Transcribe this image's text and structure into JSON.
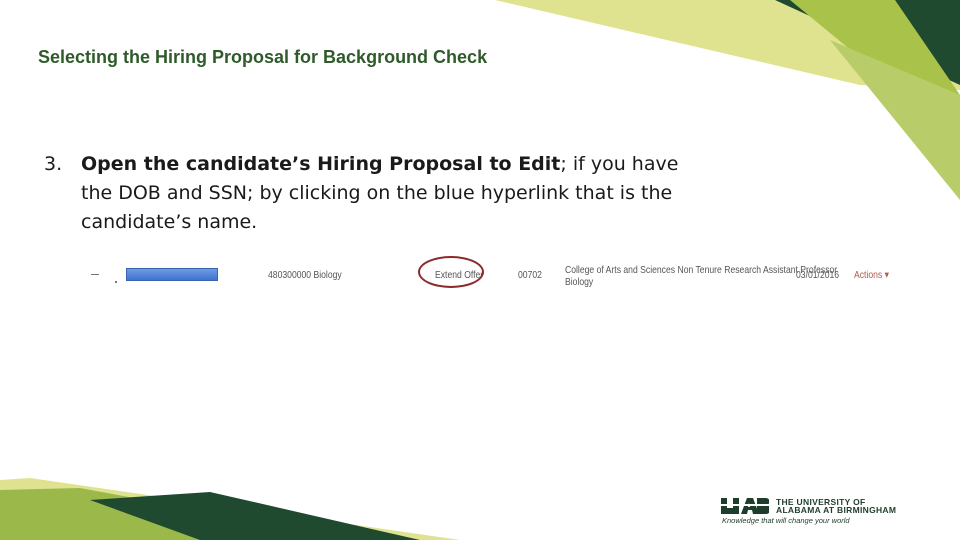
{
  "slide": {
    "title": "Selecting the Hiring Proposal for Background Check",
    "step": {
      "number": "3.",
      "bold_text": "Open the candidate’s Hiring Proposal to Edit",
      "rest_text": "; if you have the DOB and SSN; by clicking on the blue hyperlink that is the candidate’s name."
    }
  },
  "screenshot_row": {
    "department": "480300000 Biology",
    "status": "Extend Offer",
    "code": "00702",
    "position_line1": "College of Arts and Sciences Non Tenure Research Assistant Professor",
    "position_line2": "Biology",
    "date": "03/01/2016",
    "actions": "Actions ▾",
    "status_highlight_color": "#8b2a2a",
    "link_color": "#4a7fd6"
  },
  "logo": {
    "line1": "THE UNIVERSITY OF",
    "line2": "ALABAMA AT BIRMINGHAM",
    "tagline": "Knowledge that will change your world",
    "color": "#1e3d2a"
  },
  "theme": {
    "title_color": "#2f5a2a",
    "accent_light": "#d9e08a",
    "accent_mid": "#a8c04a",
    "accent_dark": "#1e4a2e"
  }
}
